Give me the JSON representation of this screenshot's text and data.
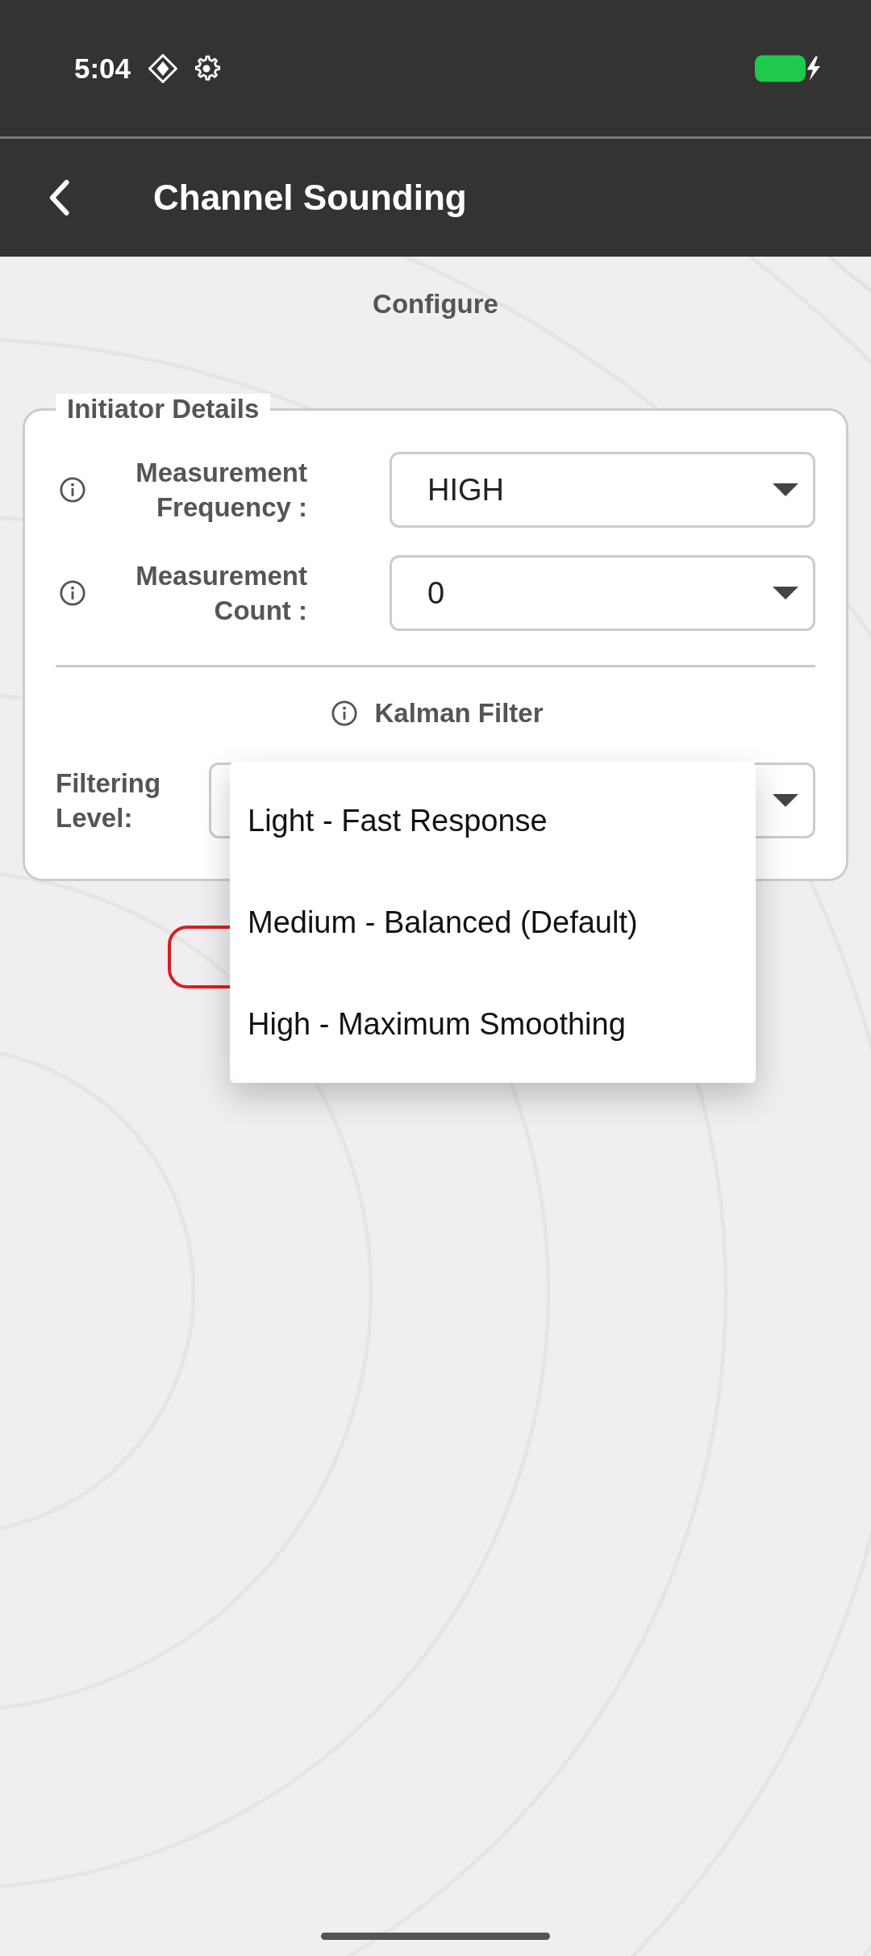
{
  "status_bar": {
    "time": "5:04"
  },
  "app_bar": {
    "title": "Channel Sounding"
  },
  "section_title": "Configure",
  "initiator_details": {
    "legend": "Initiator Details",
    "fields": [
      {
        "label": "Measurement Frequency :",
        "value": "HIGH"
      },
      {
        "label": "Measurement Count :",
        "value": "0"
      }
    ],
    "kalman_filter": {
      "title": "Kalman Filter",
      "filtering_level": {
        "label": "Filtering Level:",
        "expanded": true,
        "options": [
          "Light - Fast Response",
          "Medium - Balanced (Default)",
          "High - Maximum Smoothing"
        ]
      }
    }
  }
}
